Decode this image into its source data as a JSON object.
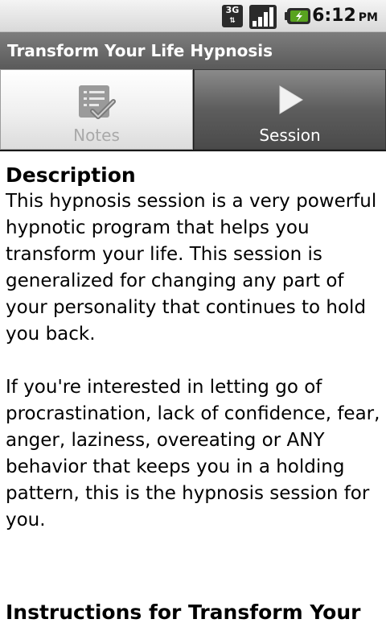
{
  "status_bar": {
    "network_type": "3G",
    "time": "6:12",
    "ampm": "PM",
    "icons": [
      "3g-icon",
      "signal-icon",
      "battery-icon"
    ]
  },
  "app": {
    "title": "Transform Your Life Hypnosis"
  },
  "tabs": [
    {
      "label": "Notes",
      "icon": "notes-checklist-icon",
      "selected": true
    },
    {
      "label": "Session",
      "icon": "play-icon",
      "selected": false
    }
  ],
  "content": {
    "heading": "Description",
    "paragraphs": [
      "This hypnosis session is a very powerful hypnotic program that helps you transform your life. This session is generalized for changing any part of your personality that continues to hold you back.",
      "If you're interested in letting go of procrastination, lack of confidence, fear, anger, laziness, overeating or ANY behavior that keeps you in a holding pattern, this is the hypnosis session for you."
    ],
    "heading2": "Instructions for Transform Your"
  },
  "colors": {
    "title_bar": "#6b6b6b",
    "tab_selected_bg": "#eeeeee",
    "tab_unselected_bg": "#5d5d5d",
    "text": "#000000"
  }
}
